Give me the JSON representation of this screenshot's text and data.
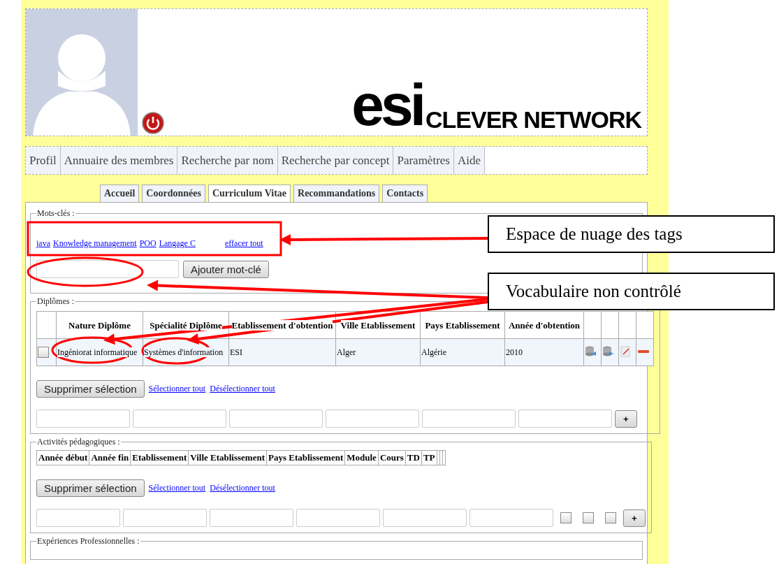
{
  "header": {
    "logo_mark": "esi",
    "logo_text": "CLEVER NETWORK"
  },
  "nav": [
    {
      "label": "Profil"
    },
    {
      "label": "Annuaire des membres"
    },
    {
      "label": "Recherche par nom"
    },
    {
      "label": "Recherche par concept"
    },
    {
      "label": "Paramètres"
    },
    {
      "label": "Aide"
    }
  ],
  "tabs": [
    {
      "label": "Accueil",
      "selected": false
    },
    {
      "label": "Coordonnées",
      "selected": false
    },
    {
      "label": "Curriculum Vitae",
      "selected": true
    },
    {
      "label": "Recommandations",
      "selected": false
    },
    {
      "label": "Contacts",
      "selected": false
    }
  ],
  "keywords": {
    "legend": "Mots-clés :",
    "tags": [
      "java",
      "Knowledge management",
      "POO",
      "Langage C"
    ],
    "clear_link": "effacer tout",
    "add_button": "Ajouter mot-clé"
  },
  "diplomas": {
    "legend": "Diplômes :",
    "columns": [
      "Nature Diplôme",
      "Spécialité Diplôme",
      "Etablissement d'obtention",
      "Ville Etablissement",
      "Pays Etablissement",
      "Année d'obtention"
    ],
    "rows": [
      {
        "checked": false,
        "cells": [
          "Ingéniorat informatique",
          "Systèmes d'information",
          "ESI",
          "Alger",
          "Algérie",
          "2010"
        ]
      }
    ],
    "delete_button": "Supprimer sélection",
    "select_all": "Sélectionner tout",
    "deselect_all": "Désélectionner tout",
    "add_row_button": "+"
  },
  "activities": {
    "legend": "Activités pédagogiques :",
    "columns": [
      "Année début",
      "Année fin",
      "Etablissement",
      "Ville Etablissement",
      "Pays Etablissement",
      "Module",
      "Cours",
      "TD",
      "TP"
    ],
    "delete_button": "Supprimer sélection",
    "select_all": "Sélectionner tout",
    "deselect_all": "Désélectionner tout",
    "checkboxes": [
      {
        "checked": false
      },
      {
        "checked": false
      },
      {
        "checked": false
      }
    ],
    "add_row_button": "+"
  },
  "experiences": {
    "legend": "Expériences Professionnelles :"
  },
  "annotations": [
    {
      "kind": "callout",
      "text": "Espace de nuage des tags"
    },
    {
      "kind": "callout",
      "text": "Vocabulaire non contrôlé"
    }
  ]
}
